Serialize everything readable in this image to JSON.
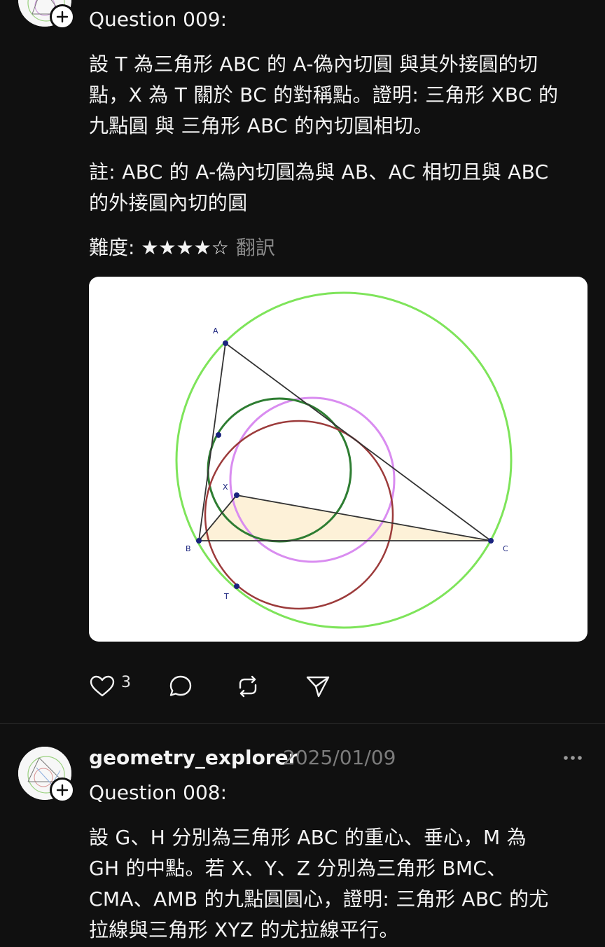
{
  "colors": {
    "background": "#101010",
    "text": "#f3f3f3",
    "muted": "#8a8a8a",
    "circumcircle": "#7ee45a",
    "incircle": "#2e7d32",
    "nine_point_circle": "#d98cf0",
    "mixtilinear_circle": "#9c3b3b",
    "triangle_fill": "#fdf1d8",
    "point": "#1a237e"
  },
  "post1": {
    "avatar_icon": "geometry-figure-avatar",
    "follow_icon": "plus-icon",
    "question_title": "Question 009:",
    "body_lines": [
      "設 T 為三角形 ABC 的 A-偽內切圓 與其外接圓的切",
      "點，X 為 T 關於 BC 的對稱點。證明: 三角形 XBC 的",
      "九點圓 與 三角形 ABC 的內切圓相切。"
    ],
    "note_lines": [
      "註: ABC 的 A-偽內切圓為與 AB、AC 相切且與 ABC",
      "的外接圓內切的圓"
    ],
    "difficulty_label": "難度: ★★★★☆",
    "translate_label": "翻訳",
    "figure": {
      "labels": {
        "A": "A",
        "B": "B",
        "C": "C",
        "X": "X",
        "T": "T"
      }
    },
    "actions": {
      "like_icon": "heart-icon",
      "like_count": "3",
      "comment_icon": "comment-icon",
      "repost_icon": "repost-icon",
      "share_icon": "send-icon"
    }
  },
  "post2": {
    "avatar_icon": "geometry-figure-avatar",
    "follow_icon": "plus-icon",
    "username": "geometry_explorer",
    "date": "2025/01/09",
    "more_icon": "more-icon",
    "question_title": "Question 008:",
    "body_lines": [
      "設 G、H 分別為三角形 ABC 的重心、垂心，M 為",
      "GH 的中點。若 X、Y、Z 分別為三角形 BMC、",
      "CMA、AMB 的九點圓圓心，證明: 三角形 ABC 的尤",
      "拉線與三角形 XYZ 的尤拉線平行。"
    ]
  }
}
